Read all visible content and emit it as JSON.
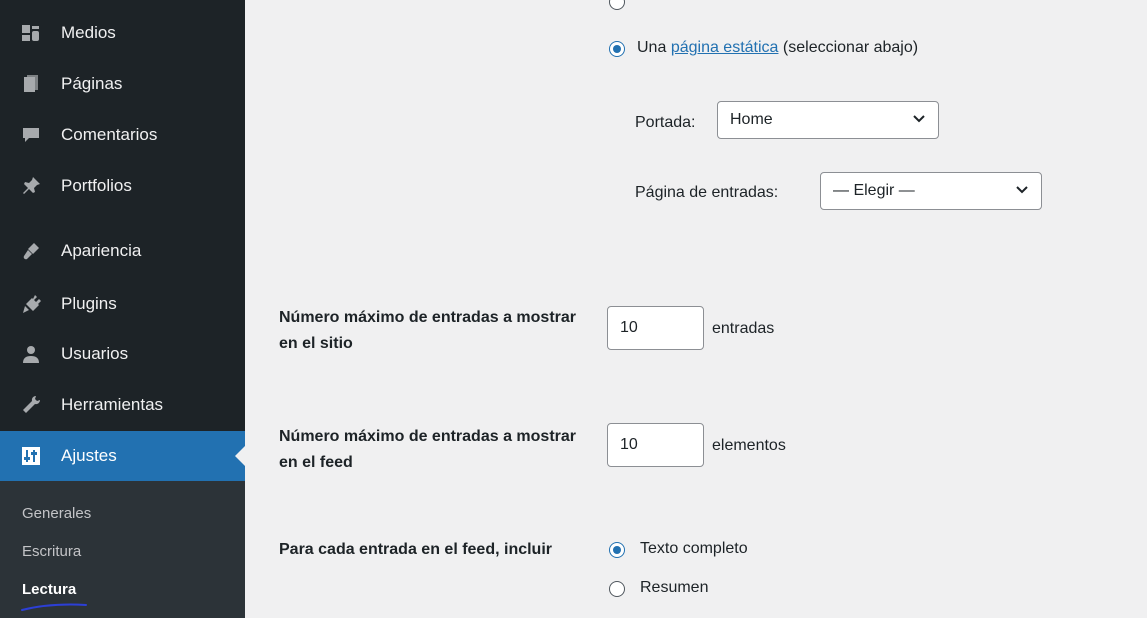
{
  "sidebar": {
    "items": [
      {
        "label": "Medios",
        "icon": "media-icon"
      },
      {
        "label": "Páginas",
        "icon": "pages-icon"
      },
      {
        "label": "Comentarios",
        "icon": "comments-icon"
      },
      {
        "label": "Portfolios",
        "icon": "pin-icon"
      },
      {
        "label": "Apariencia",
        "icon": "appearance-icon"
      },
      {
        "label": "Plugins",
        "icon": "plugins-icon"
      },
      {
        "label": "Usuarios",
        "icon": "users-icon"
      },
      {
        "label": "Herramientas",
        "icon": "tools-icon"
      },
      {
        "label": "Ajustes",
        "icon": "settings-icon"
      }
    ],
    "submenu": [
      "Generales",
      "Escritura",
      "Lectura"
    ],
    "accent_color": "#2271b1"
  },
  "homepage": {
    "static_option_prefix": "Una",
    "static_option_link": "página estática",
    "static_option_suffix": "(seleccionar abajo)",
    "front_label": "Portada:",
    "front_value": "Home",
    "posts_label": "Página de entradas:",
    "posts_value": "— Elegir —"
  },
  "posts_per_page": {
    "label": "Número máximo de entradas a mostrar en el sitio",
    "value": "10",
    "unit": "entradas"
  },
  "posts_per_rss": {
    "label": "Número máximo de entradas a mostrar en el feed",
    "value": "10",
    "unit": "elementos"
  },
  "rss_use_excerpt": {
    "label": "Para cada entrada en el feed, incluir",
    "option_full": "Texto completo",
    "option_summary": "Resumen"
  }
}
